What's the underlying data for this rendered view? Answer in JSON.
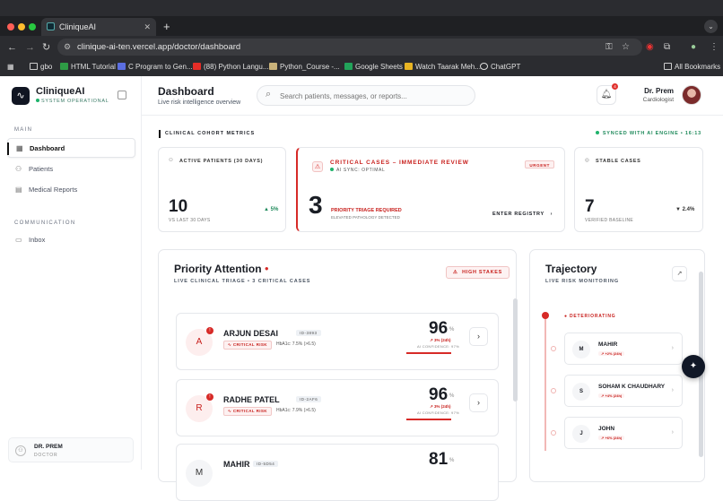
{
  "browser": {
    "tab_title": "CliniqueAI",
    "url": "clinique-ai-ten.vercel.app/doctor/dashboard",
    "bookmarks": [
      "gbo",
      "HTML Tutorial",
      "C Program to Gen...",
      "(88) Python Langu...",
      "Python_Course -...",
      "Google Sheets",
      "Watch Taarak Meh...",
      "ChatGPT"
    ],
    "all_bookmarks": "All Bookmarks"
  },
  "sidebar": {
    "brand": "CliniqueAI",
    "status": "SYSTEM OPERATIONAL",
    "section_main": "MAIN",
    "items": [
      {
        "label": "Dashboard",
        "icon": "grid-icon"
      },
      {
        "label": "Patients",
        "icon": "users-icon"
      },
      {
        "label": "Medical Reports",
        "icon": "document-icon"
      }
    ],
    "section_comm": "COMMUNICATION",
    "inbox": "Inbox",
    "user": {
      "name": "DR. PREM",
      "role": "DOCTOR"
    }
  },
  "header": {
    "title": "Dashboard",
    "subtitle": "Live risk intelligence overview",
    "search_placeholder": "Search patients, messages, or reports...",
    "notification_count": "4",
    "doctor_name": "Dr. Prem",
    "doctor_role": "Cardiologist"
  },
  "metrics": {
    "section_title": "CLINICAL COHORT METRICS",
    "synced": "SYNCED WITH AI ENGINE • 16:13",
    "active": {
      "label": "ACTIVE PATIENTS (30 DAYS)",
      "value": "10",
      "change": "▲ 5%",
      "foot": "VS LAST 30 DAYS"
    },
    "critical": {
      "title": "CRITICAL CASES – IMMEDIATE REVIEW",
      "sync": "AI SYNC: OPTIMAL",
      "badge": "URGENT",
      "value": "3",
      "line1": "PRIORITY TRIAGE REQUIRED",
      "line2": "ELEVATED PATHOLOGY DETECTED",
      "action": "ENTER REGISTRY"
    },
    "stable": {
      "label": "STABLE CASES",
      "value": "7",
      "change": "▼ 2.4%",
      "foot": "VERIFIED BASELINE"
    }
  },
  "priority": {
    "title": "Priority Attention",
    "subtitle": "LIVE CLINICAL TRIAGE • 3 CRITICAL CASES",
    "badge": "HIGH STAKES",
    "patients": [
      {
        "initial": "A",
        "name": "ARJUN DESAI",
        "id": "ID-3893",
        "tag": "CRITICAL RISK",
        "lab": "HbA1c: 7.5% (>6.5)",
        "score": "96",
        "unit": "%",
        "trend": "↗ 3% (24h)",
        "confidence": "AI CONFIDENCE: 97%"
      },
      {
        "initial": "R",
        "name": "RADHE PATEL",
        "id": "ID-2AF6",
        "tag": "CRITICAL RISK",
        "lab": "HbA1c: 7.9% (>6.5)",
        "score": "96",
        "unit": "%",
        "trend": "↗ 3% (24h)",
        "confidence": "AI CONFIDENCE: 97%"
      },
      {
        "initial": "M",
        "name": "MAHIR",
        "id": "ID-5D54",
        "tag": "",
        "lab": "",
        "score": "81",
        "unit": "%",
        "trend": "",
        "confidence": ""
      }
    ]
  },
  "trajectory": {
    "title": "Trajectory",
    "subtitle": "LIVE RISK MONITORING",
    "status": "DETERIORATING",
    "items": [
      {
        "initial": "M",
        "name": "MAHIR",
        "trend": "↗ +2% (24h)"
      },
      {
        "initial": "S",
        "name": "SOHAM K CHAUDHARY",
        "trend": "↗ +4% (24h)"
      },
      {
        "initial": "J",
        "name": "JOHN",
        "trend": "↗ +6% (24h)"
      }
    ]
  },
  "colors": {
    "critical": "#d72a27",
    "success": "#1fb36b",
    "dark": "#111827"
  }
}
